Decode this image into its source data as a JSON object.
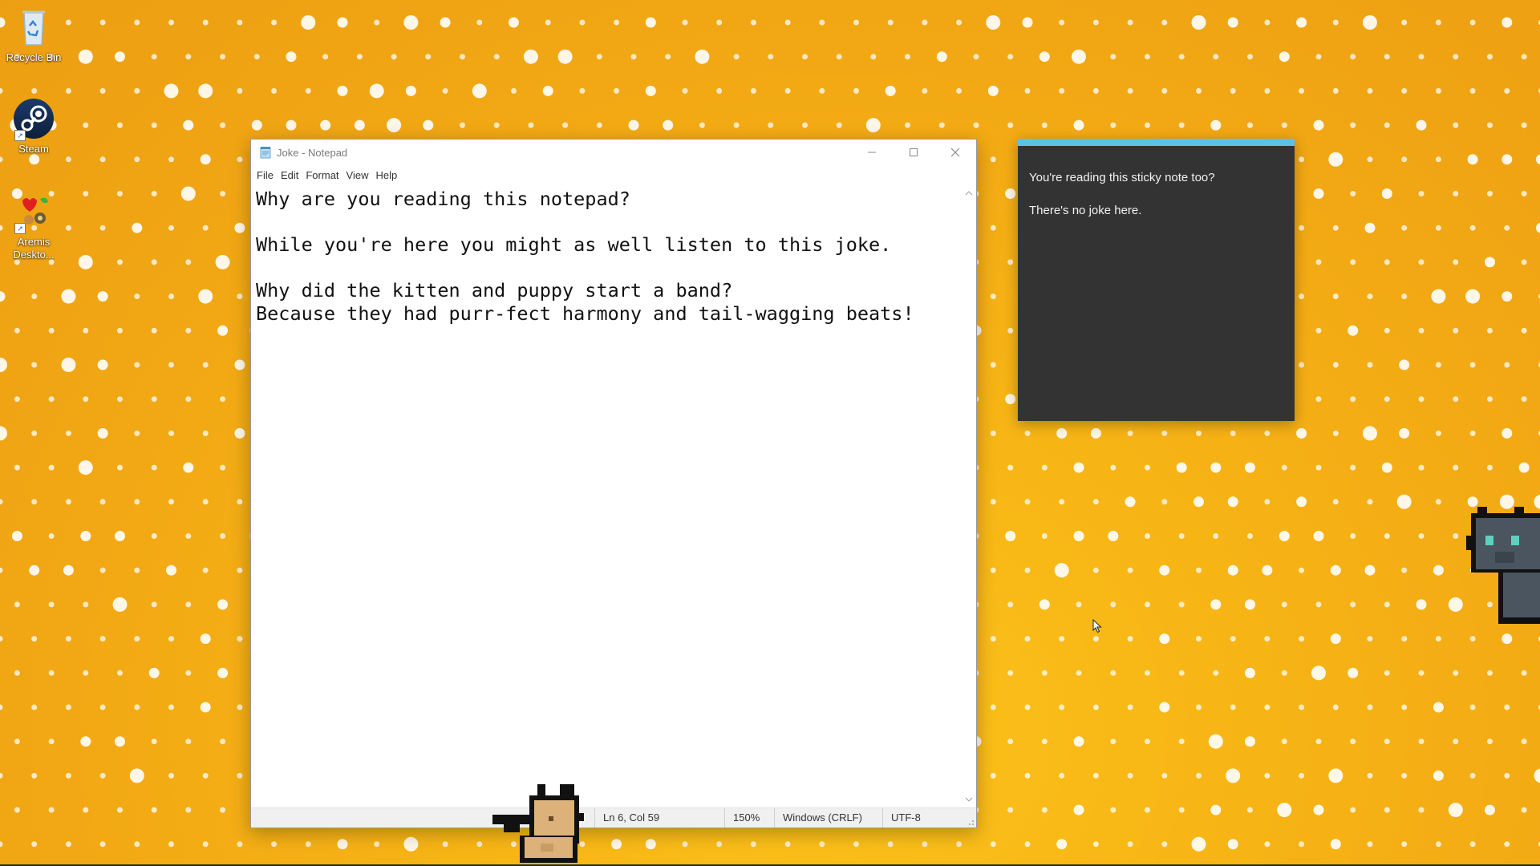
{
  "desktop": {
    "icons": [
      {
        "label": "Recycle Bin",
        "icon": "recycle-bin-icon"
      },
      {
        "label": "Steam",
        "icon": "steam-icon"
      },
      {
        "label": "Aremis Deskto...",
        "icon": "aremis-desktop-icon"
      }
    ],
    "background_color": "#f4ad15"
  },
  "notepad": {
    "title": "Joke - Notepad",
    "menu": [
      "File",
      "Edit",
      "Format",
      "View",
      "Help"
    ],
    "content": "Why are you reading this notepad?\n\nWhile you're here you might as well listen to this joke.\n\nWhy did the kitten and puppy start a band?\nBecause they had purr-fect harmony and tail-wagging beats!",
    "status": {
      "position": "Ln 6, Col 59",
      "zoom": "150%",
      "line_ending": "Windows (CRLF)",
      "encoding": "UTF-8"
    }
  },
  "sticky_note": {
    "lines": [
      "You're reading this sticky note too?",
      "There's no joke here."
    ],
    "accent_color": "#5dc1e6",
    "background_color": "#333333"
  },
  "pets": [
    "pixel-cat-tan-icon",
    "pixel-cat-gray-icon"
  ]
}
